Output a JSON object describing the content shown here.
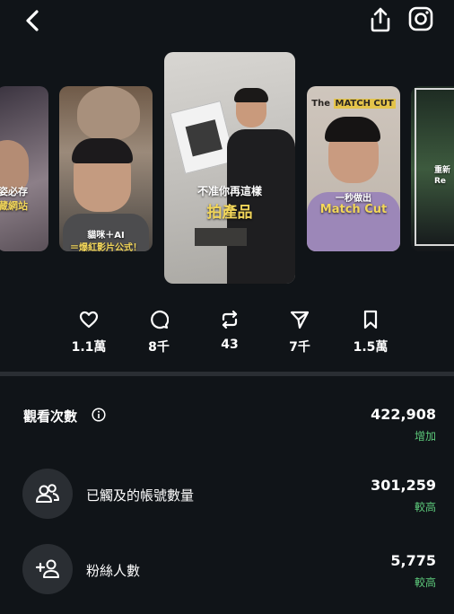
{
  "header": {
    "back_icon": "chevron-left-icon",
    "share_icon": "share-icon",
    "instagram_icon": "instagram-icon"
  },
  "reels": [
    {
      "caption_lines": [
        "姿必存",
        "藏網站"
      ]
    },
    {
      "caption_lines": [
        "貓咪＋AI",
        "＝爆紅影片公式！"
      ]
    },
    {
      "caption_top": "不准你再這樣",
      "caption_main": "拍產品"
    },
    {
      "title_prefix": "The ",
      "title_highlight": "MATCH CUT",
      "caption_top": "一秒做出",
      "caption_main": "Match Cut"
    },
    {
      "caption_lines": [
        "重新",
        "Re"
      ]
    }
  ],
  "actions": [
    {
      "icon": "heart-icon",
      "value": "1.1萬"
    },
    {
      "icon": "comment-icon",
      "value": "8千"
    },
    {
      "icon": "repost-icon",
      "value": "43"
    },
    {
      "icon": "send-icon",
      "value": "7千"
    },
    {
      "icon": "bookmark-icon",
      "value": "1.5萬"
    }
  ],
  "metrics": {
    "views": {
      "label": "觀看次數",
      "value": "422,908",
      "change": "增加",
      "icon": "info-icon"
    },
    "accounts_reached": {
      "label": "已觸及的帳號數量",
      "value": "301,259",
      "change": "較高",
      "icon": "people-icon"
    },
    "followers": {
      "label": "粉絲人數",
      "value": "5,775",
      "change": "較高",
      "icon": "add-user-icon"
    }
  },
  "colors": {
    "background": "#101418",
    "positive": "#5cc87a",
    "highlight": "#f2d65a"
  }
}
